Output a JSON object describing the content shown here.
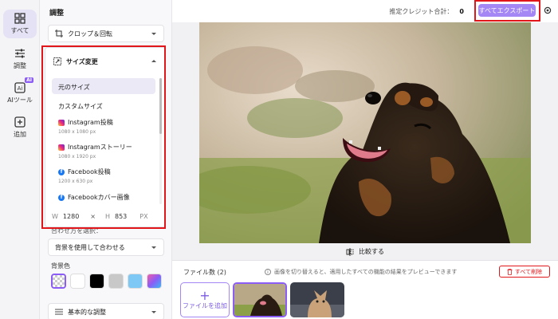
{
  "rail": {
    "items": [
      {
        "label": "すべて",
        "icon": "grid-icon",
        "active": true
      },
      {
        "label": "調整",
        "icon": "sliders-icon",
        "active": false
      },
      {
        "label": "AIツール",
        "icon": "ai-icon",
        "active": false,
        "badge": "AI"
      },
      {
        "label": "追加",
        "icon": "plus-square-icon",
        "active": false
      }
    ]
  },
  "panel": {
    "title": "調整",
    "crop_label": "クロップ＆回転",
    "resize": {
      "label": "サイズ変更",
      "options": [
        {
          "name": "元のサイズ",
          "sub": "",
          "icon": "",
          "selected": true
        },
        {
          "name": "カスタムサイズ",
          "sub": "",
          "icon": "",
          "selected": false
        },
        {
          "name": "Instagram投稿",
          "sub": "1080 x 1080 px",
          "icon": "instagram-icon",
          "selected": false
        },
        {
          "name": "Instagramストーリー",
          "sub": "1080 x 1920 px",
          "icon": "instagram-icon",
          "selected": false
        },
        {
          "name": "Facebook投稿",
          "sub": "1200 x 630 px",
          "icon": "facebook-icon",
          "selected": false
        },
        {
          "name": "Facebookカバー画像",
          "sub": "",
          "icon": "facebook-icon",
          "selected": false
        }
      ],
      "width_label": "W",
      "width_value": "1280",
      "times": "×",
      "height_label": "H",
      "height_value": "853",
      "unit": "PX"
    },
    "fit_label": "合わせ方を選択：",
    "fit_value": "背景を使用して合わせる",
    "bgcolor_label": "背景色",
    "swatches": [
      "transparent",
      "#ffffff",
      "#000000",
      "#c8c8c8",
      "#7dc8f5",
      "gradient"
    ],
    "basic_adjust_label": "基本的な調整"
  },
  "topbar": {
    "estimate_label": "推定クレジット合計：",
    "estimate_value": "0",
    "export_label": "すべてエクスポート"
  },
  "compare_label": "比較する",
  "files": {
    "count_label": "ファイル数 (2)",
    "hint": "画像を切り替えると、適用したすべての機能の結果をプレビューできます",
    "delete_all": "すべて削除",
    "add_label": "ファイルを追加",
    "add_symbol": "+"
  },
  "colors": {
    "accent": "#8b5cf6",
    "highlight": "#e0161b",
    "export_bg": "#a487f5"
  }
}
